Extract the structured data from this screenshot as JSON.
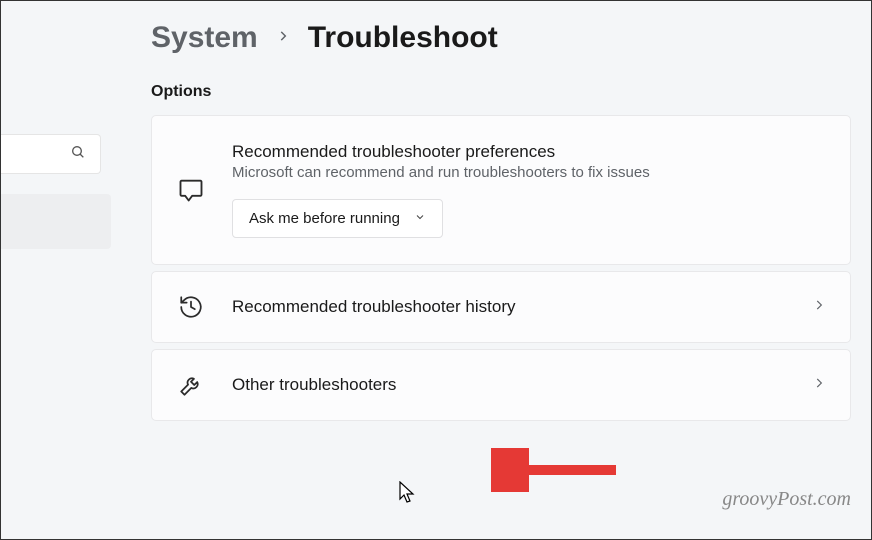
{
  "breadcrumb": {
    "parent": "System",
    "current": "Troubleshoot"
  },
  "section_label": "Options",
  "cards": {
    "preferences": {
      "title": "Recommended troubleshooter preferences",
      "subtitle": "Microsoft can recommend and run troubleshooters to fix issues",
      "dropdown_value": "Ask me before running"
    },
    "history": {
      "title": "Recommended troubleshooter history"
    },
    "other": {
      "title": "Other troubleshooters"
    }
  },
  "watermark": "groovyPost.com"
}
